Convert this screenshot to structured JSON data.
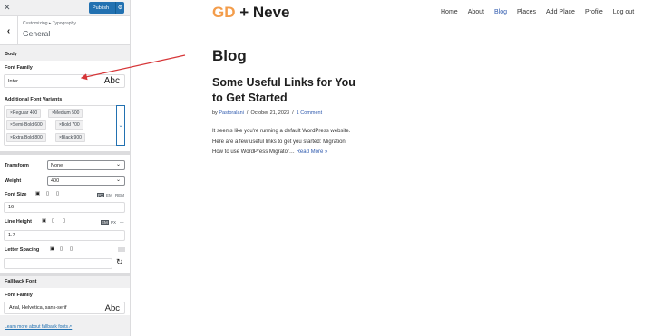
{
  "customizer": {
    "publish_label": "Publish",
    "breadcrumb": "Customizing ▸ Typography",
    "section_title": "General",
    "body_group": "Body",
    "font_family_label": "Font Family",
    "font_family_value": "Inter",
    "font_preview": "Abc",
    "variants_label": "Additional Font Variants",
    "variants": [
      "Regular 400",
      "Medium 500",
      "Semi-Bold 600",
      "Bold 700",
      "Extra Bold 800",
      "Black 900"
    ],
    "transform_label": "Transform",
    "transform_value": "None",
    "weight_label": "Weight",
    "weight_value": "400",
    "font_size_label": "Font Size",
    "font_size_value": "16",
    "font_size_units": [
      "PX",
      "EM",
      "REM"
    ],
    "line_height_label": "Line Height",
    "line_height_value": "1.7",
    "line_height_units": [
      "EM",
      "PX",
      "—"
    ],
    "letter_spacing_label": "Letter Spacing",
    "fallback_group": "Fallback Font",
    "fallback_family_label": "Font Family",
    "fallback_value": "Arial, Helvetica, sans-serif",
    "fallback_preview": "Abc",
    "learn_more": "Learn more about fallback fonts"
  },
  "site": {
    "logo_gd": "GD",
    "logo_rest": " + Neve",
    "nav": [
      "Home",
      "About",
      "Blog",
      "Places",
      "Add Place",
      "Profile",
      "Log out"
    ],
    "active_nav": "Blog",
    "page_title": "Blog",
    "post_title": "Some Useful Links for You to Get Started",
    "meta_by": "by",
    "meta_author": "Pastoralani",
    "meta_date": "October 21, 2023",
    "meta_comments": "1 Comment",
    "excerpt": "It seems like you're running a default WordPress website. Here are a few useful links to get you started: Migration How to use WordPress Migrator…",
    "read_more": "Read More »"
  },
  "colors": {
    "accent": "#2271b1",
    "logo_accent": "#f39c4a",
    "link": "#2f5aae",
    "annotation_arrow": "#d63638"
  }
}
